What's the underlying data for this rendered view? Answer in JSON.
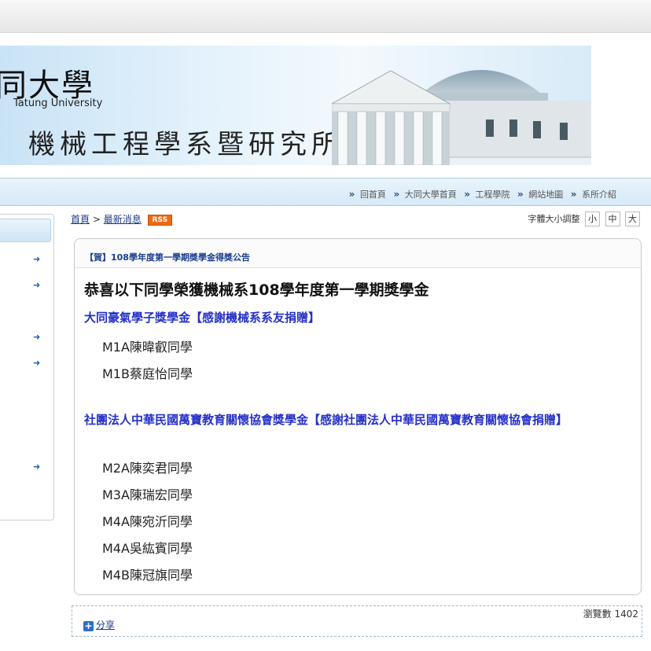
{
  "banner": {
    "logo_cn": "同大學",
    "logo_en": "Tatung University",
    "dept_title": "機械工程學系暨研究所"
  },
  "nav": {
    "items": [
      "回首頁",
      "大同大學首頁",
      "工程學院",
      "網站地圖",
      "系所介紹"
    ]
  },
  "breadcrumb": {
    "home": "首頁",
    "sep": ">",
    "current": "最新消息",
    "rss": "RSS"
  },
  "font_size": {
    "label": "字體大小調整",
    "small": "小",
    "medium": "中",
    "large": "大"
  },
  "article": {
    "header_title": "【賀】108學年度第一學期獎學金得獎公告",
    "headline": "恭喜以下同學榮獲機械系108學年度第一學期獎學金",
    "scholarship1": "大同豪氣學子獎學金【感謝機械系系友捐贈】",
    "students1": [
      "M1A陳暐叡同學",
      "M1B蔡庭怡同學"
    ],
    "scholarship2": "社團法人中華民國萬寶教育關懷協會獎學金【感謝社團法人中華民國萬寶教育關懷協會捐贈】",
    "students2": [
      "M2A陳奕君同學",
      "M3A陳瑞宏同學",
      "M4A陳宛沂同學",
      "M4A吳紘賓同學",
      "M4B陳冠旗同學"
    ]
  },
  "footer": {
    "views_label": "瀏覽數",
    "views_count": "1402",
    "share": "分享"
  },
  "colors": {
    "link": "#1a3d8f",
    "scholarship": "#2530c8",
    "rss": "#ee6a14"
  }
}
